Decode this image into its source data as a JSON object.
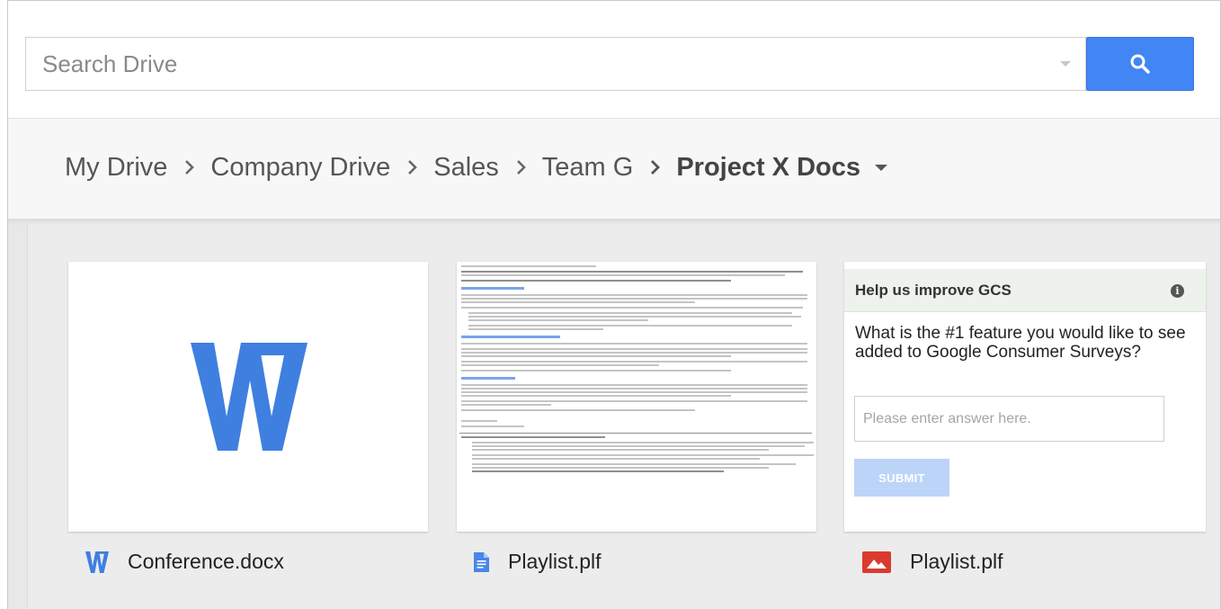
{
  "search": {
    "placeholder": "Search Drive",
    "button_icon": "search-icon"
  },
  "breadcrumb": {
    "items": [
      "My Drive",
      "Company Drive",
      "Sales",
      "Team G"
    ],
    "current": "Project X Docs"
  },
  "files": [
    {
      "name": "Conference.docx",
      "icon": "word-doc-icon",
      "thumbnail": "word-logo"
    },
    {
      "name": "Playlist.plf",
      "icon": "google-doc-icon",
      "thumbnail": "document-preview"
    },
    {
      "name": "Playlist.plf",
      "icon": "image-file-icon",
      "thumbnail": "survey-widget"
    }
  ],
  "survey": {
    "title": "Help us improve GCS",
    "question": "What is the #1 feature you would like to see added to Google Consumer Surveys?",
    "answer_placeholder": "Please enter answer here.",
    "submit_label": "SUBMIT"
  },
  "colors": {
    "accent_blue": "#4285f4",
    "word_blue": "#3f7fe0",
    "image_red": "#d93b2e",
    "submit_disabled": "#bcd4f8"
  }
}
